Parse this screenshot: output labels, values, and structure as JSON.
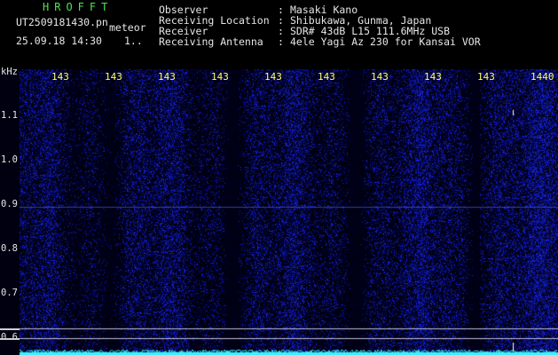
{
  "header": {
    "brand": "HROFFT",
    "filename": "UT2509181430.pn",
    "meteor_label": "meteor",
    "datetime": "25.09.18 14:30",
    "count": "1..",
    "fields": [
      {
        "label": "Observer",
        "sep": ":",
        "value": "Masaki Kano"
      },
      {
        "label": "Receiving Location",
        "sep": ":",
        "value": "Shibukawa, Gunma, Japan"
      },
      {
        "label": "Receiver",
        "sep": ":",
        "value": "SDR# 43dB L15 111.6MHz USB"
      },
      {
        "label": "Receiving Antenna",
        "sep": ":",
        "value": "4ele Yagi Az 230 for Kansai VOR"
      }
    ]
  },
  "axis": {
    "unit": "kHz",
    "time_ticks": [
      "143",
      "143",
      "143",
      "143",
      "143",
      "143",
      "143",
      "143",
      "143",
      "1440"
    ],
    "freq_ticks": [
      "1.1",
      "1.0",
      "0.9",
      "0.8",
      "0.7",
      "0.6"
    ]
  },
  "colors": {
    "background": "#000000",
    "signal": "#1a2bd6",
    "noise_floor": "#3ff0ff",
    "tick": "#ffff66",
    "brand": "#4ee34e"
  }
}
